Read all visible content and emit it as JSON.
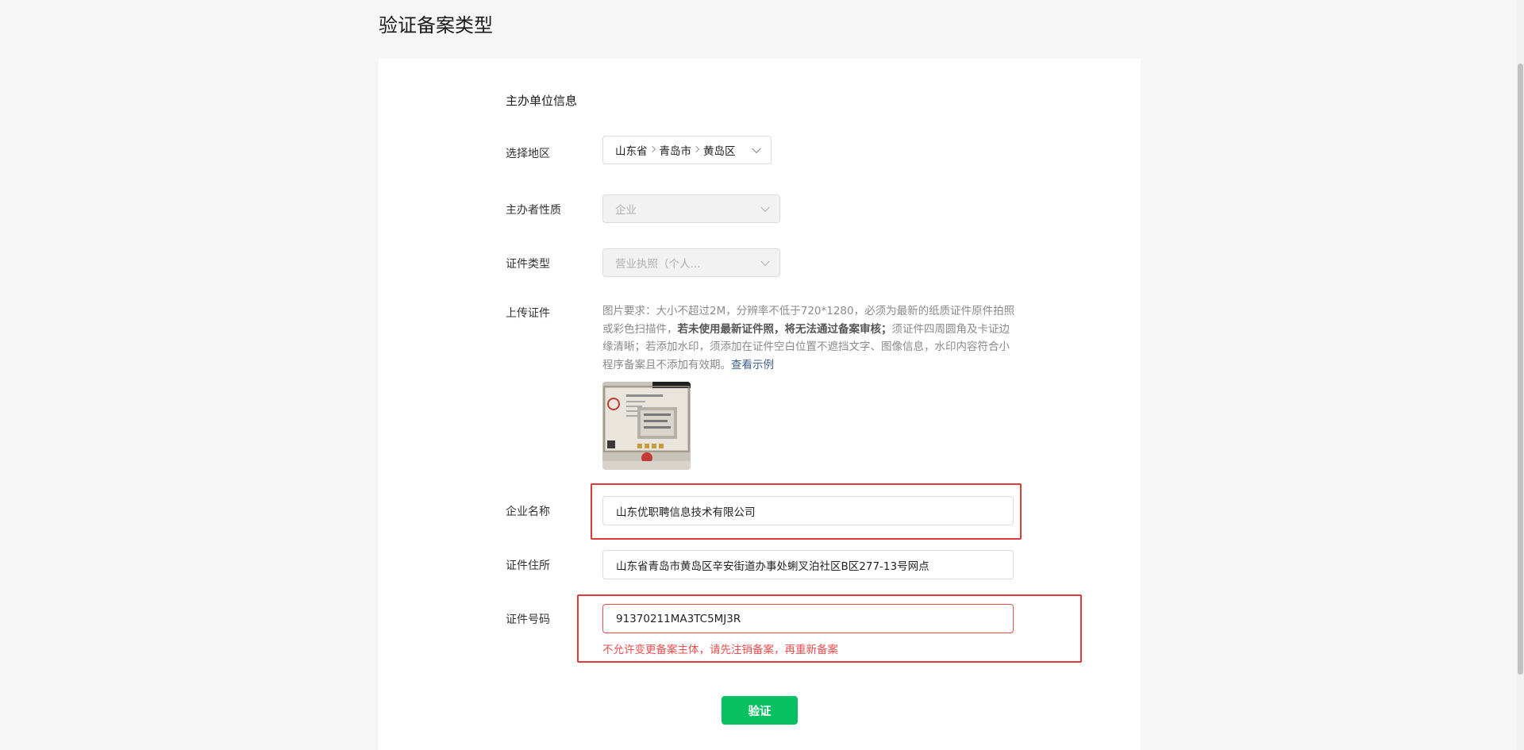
{
  "page": {
    "title": "验证备案类型"
  },
  "section": {
    "title": "主办单位信息"
  },
  "region": {
    "label": "选择地区",
    "province": "山东省",
    "city": "青岛市",
    "district": "黄岛区"
  },
  "organizer_type": {
    "label": "主办者性质",
    "value": "企业"
  },
  "certificate_type": {
    "label": "证件类型",
    "value": "营业执照（个人..."
  },
  "upload": {
    "label": "上传证件",
    "desc_part1": "图片要求：大小不超过2M，分辨率不低于720*1280，必须为最新的纸质证件原件拍照或彩色扫描件，",
    "desc_bold": "若未使用最新证件照，将无法通过备案审核；",
    "desc_part2": "须证件四周圆角及卡证边缘清晰；若添加水印，须添加在证件空白位置不遮挡文字、图像信息，水印内容符合小程序备案且不添加有效期。",
    "example_link": "查看示例"
  },
  "company_name": {
    "label": "企业名称",
    "value": "山东优职聘信息技术有限公司"
  },
  "address": {
    "label": "证件住所",
    "value": "山东省青岛市黄岛区辛安街道办事处蜊叉泊社区B区277-13号网点"
  },
  "cert_number": {
    "label": "证件号码",
    "value": "91370211MA3TC5MJ3R",
    "error": "不允许变更备案主体，请先注销备案，再重新备案"
  },
  "actions": {
    "verify_label": "验证"
  },
  "colors": {
    "primary": "#07c160",
    "error": "#ea4f4f",
    "link": "#3d5f8f",
    "highlight": "#e03a3a"
  }
}
